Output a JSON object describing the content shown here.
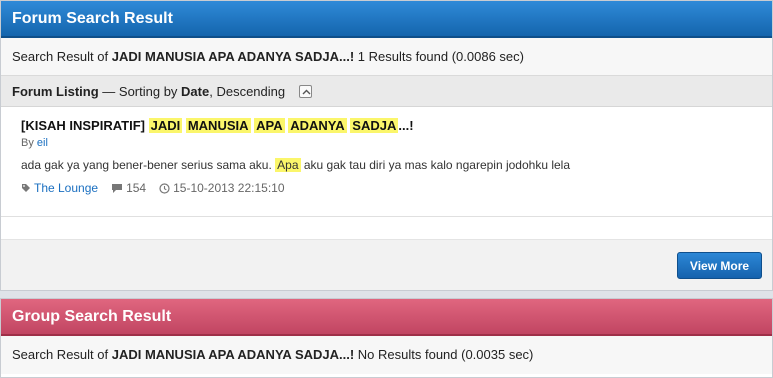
{
  "forum": {
    "header_title": "Forum Search Result",
    "result": {
      "prefix": "Search Result of ",
      "query": "JADI MANUSIA APA ADANYA SADJA...!",
      "suffix": " 1 Results found (0.0086 sec)"
    },
    "listing": {
      "label": "Forum Listing",
      "sort_prefix": " — Sorting by ",
      "sort_field": "Date",
      "sort_order": ", Descending"
    },
    "item": {
      "title_prefix": "[KISAH INSPIRATIF] ",
      "title_words": [
        "JADI",
        "MANUSIA",
        "APA",
        "ADANYA",
        "SADJA"
      ],
      "title_suffix": "...!",
      "by_label": "By ",
      "author": "eil",
      "snippet_before": "ada gak ya yang bener-bener serius sama aku. ",
      "snippet_highlight": "Apa",
      "snippet_after": " aku gak tau diri ya mas kalo ngarepin jodohku lela",
      "forum_name": "The Lounge",
      "reply_count": "154",
      "timestamp": "15-10-2013 22:15:10"
    },
    "view_more_label": "View More"
  },
  "group": {
    "header_title": "Group Search Result",
    "result": {
      "prefix": "Search Result of ",
      "query": "JADI MANUSIA APA ADANYA SADJA...!",
      "suffix": " No Results found (0.0035 sec)"
    }
  },
  "colors": {
    "forum_header": "#1a72c2",
    "group_header": "#d2566f",
    "highlight": "#fbf66b",
    "link": "#1a6fc0"
  },
  "icons": {
    "collapse": "collapse-up-icon",
    "tag": "tag-icon",
    "comment": "comment-icon",
    "clock": "clock-icon"
  }
}
